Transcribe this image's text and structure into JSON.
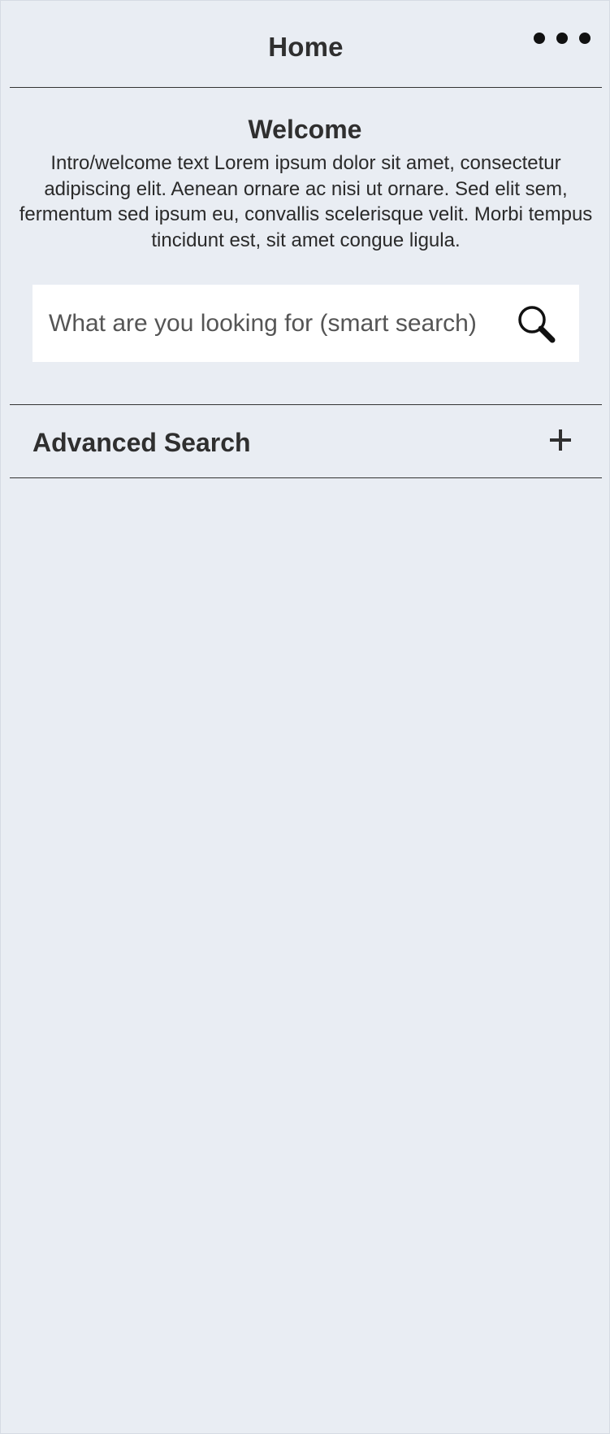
{
  "header": {
    "title": "Home",
    "more_icon": "more-dots-icon"
  },
  "welcome": {
    "title": "Welcome",
    "text": "Intro/welcome text Lorem ipsum dolor sit amet, consectetur adipiscing elit. Aenean ornare ac nisi ut ornare. Sed elit sem, fermentum sed ipsum eu, convallis scelerisque velit. Morbi tempus tincidunt est, sit amet congue ligula."
  },
  "search": {
    "placeholder": "What are you looking for (smart search)",
    "value": "",
    "icon": "search-icon"
  },
  "advanced_search": {
    "label": "Advanced Search",
    "icon": "plus-icon"
  },
  "colors": {
    "background": "#e9edf3",
    "search_background": "#ffffff",
    "text": "#2f2f2f",
    "divider": "#333333"
  }
}
